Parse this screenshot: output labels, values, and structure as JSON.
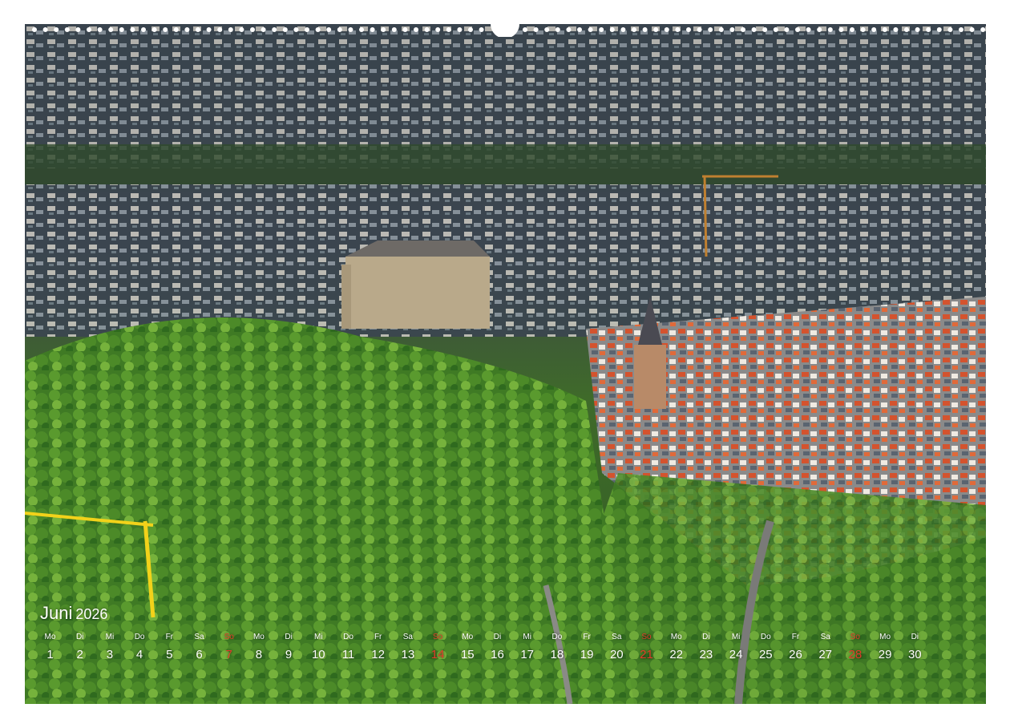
{
  "calendar": {
    "month": "Juni",
    "year": "2026",
    "days": [
      {
        "wd": "Mo",
        "num": "1"
      },
      {
        "wd": "Di",
        "num": "2"
      },
      {
        "wd": "Mi",
        "num": "3"
      },
      {
        "wd": "Do",
        "num": "4"
      },
      {
        "wd": "Fr",
        "num": "5"
      },
      {
        "wd": "Sa",
        "num": "6"
      },
      {
        "wd": "So",
        "num": "7"
      },
      {
        "wd": "Mo",
        "num": "8"
      },
      {
        "wd": "Di",
        "num": "9"
      },
      {
        "wd": "Mi",
        "num": "10"
      },
      {
        "wd": "Do",
        "num": "11"
      },
      {
        "wd": "Fr",
        "num": "12"
      },
      {
        "wd": "Sa",
        "num": "13"
      },
      {
        "wd": "So",
        "num": "14"
      },
      {
        "wd": "Mo",
        "num": "15"
      },
      {
        "wd": "Di",
        "num": "16"
      },
      {
        "wd": "Mi",
        "num": "17"
      },
      {
        "wd": "Do",
        "num": "18"
      },
      {
        "wd": "Fr",
        "num": "19"
      },
      {
        "wd": "Sa",
        "num": "20"
      },
      {
        "wd": "So",
        "num": "21"
      },
      {
        "wd": "Mo",
        "num": "22"
      },
      {
        "wd": "Di",
        "num": "23"
      },
      {
        "wd": "Mi",
        "num": "24"
      },
      {
        "wd": "Do",
        "num": "25"
      },
      {
        "wd": "Fr",
        "num": "26"
      },
      {
        "wd": "Sa",
        "num": "27"
      },
      {
        "wd": "So",
        "num": "28"
      },
      {
        "wd": "Mo",
        "num": "29"
      },
      {
        "wd": "Di",
        "num": "30"
      }
    ]
  },
  "colors": {
    "sunday": "#e23b2a",
    "text": "#ffffff"
  },
  "photo": {
    "icon": "aerial-town-photo"
  }
}
